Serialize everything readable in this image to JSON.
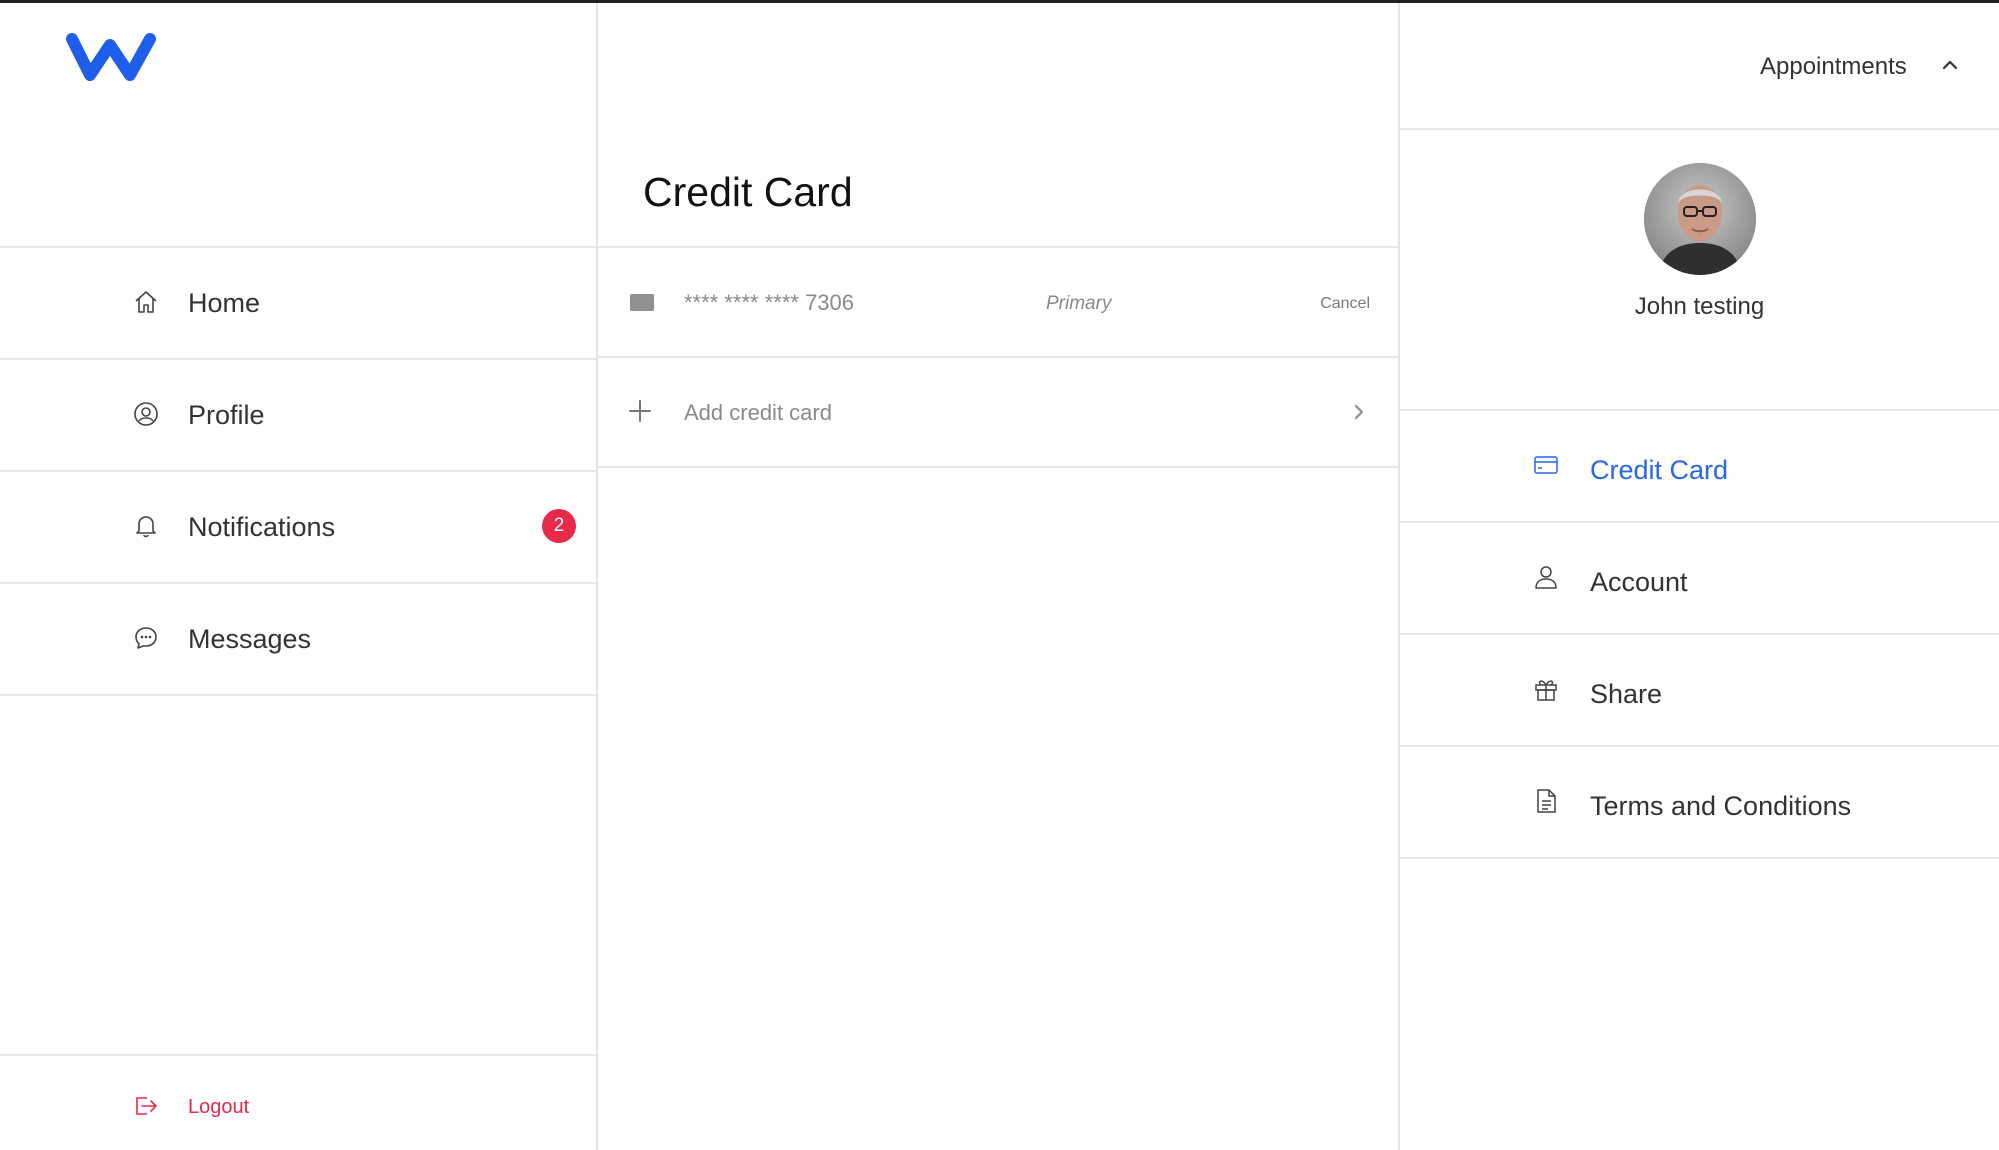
{
  "colors": {
    "brand": "#1f5eea",
    "active": "#2667ee",
    "danger": "#e8294a",
    "muted": "#8a8a8a"
  },
  "logo": {
    "icon": "brand-w-logo"
  },
  "sidebar": {
    "items": [
      {
        "label": "Home",
        "icon": "home-icon"
      },
      {
        "label": "Profile",
        "icon": "user-circle-icon"
      },
      {
        "label": "Notifications",
        "icon": "bell-icon",
        "badge": "2"
      },
      {
        "label": "Messages",
        "icon": "chat-bubble-icon"
      }
    ],
    "logout": {
      "label": "Logout",
      "icon": "logout-icon"
    }
  },
  "main": {
    "title": "Credit Card",
    "card": {
      "number": "**** **** **** 7306",
      "status": "Primary",
      "action": "Cancel",
      "icon": "card-icon"
    },
    "add_card": {
      "label": "Add credit card",
      "icon": "plus-icon",
      "chevron": "chevron-right-icon"
    }
  },
  "right": {
    "appointments": {
      "label": "Appointments",
      "icon": "chevron-up-icon"
    },
    "profile": {
      "name": "John testing"
    },
    "menu": [
      {
        "label": "Credit Card",
        "icon": "credit-card-icon",
        "active": true
      },
      {
        "label": "Account",
        "icon": "person-icon"
      },
      {
        "label": "Share",
        "icon": "gift-icon"
      },
      {
        "label": "Terms and Conditions",
        "icon": "document-icon"
      }
    ]
  }
}
